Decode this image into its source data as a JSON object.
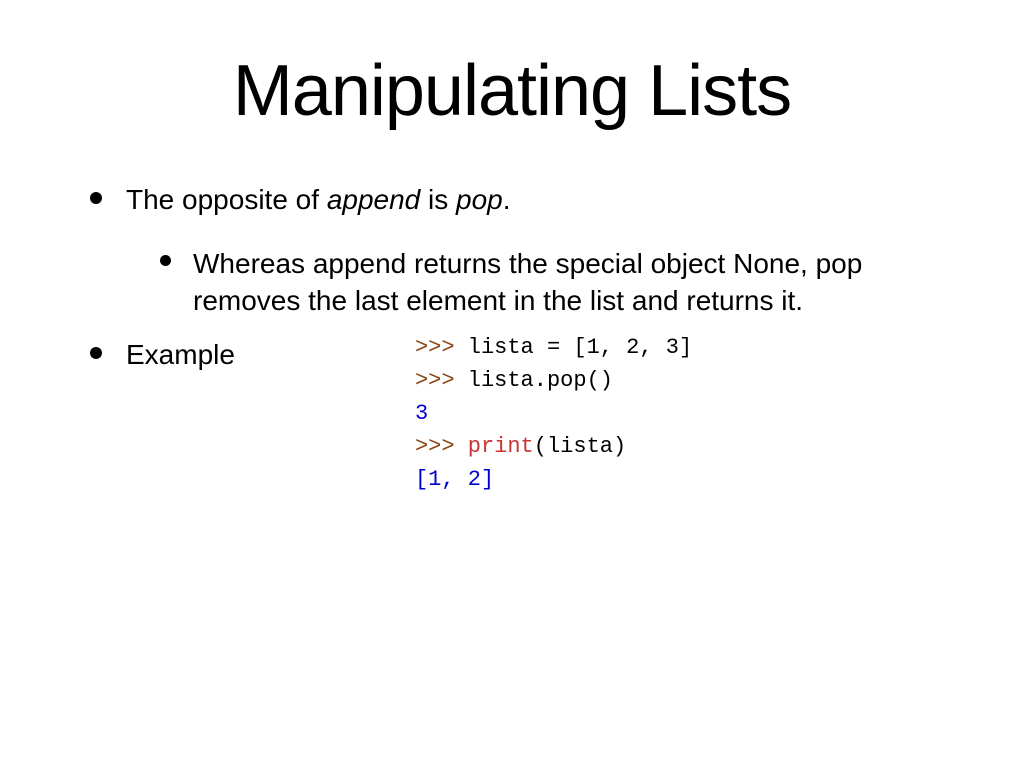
{
  "slide": {
    "title": "Manipulating Lists",
    "bullet1": {
      "prefix": "The opposite of ",
      "word_append": "append",
      "mid": " is ",
      "word_pop": "pop",
      "suffix": "."
    },
    "bullet1_sub": "Whereas append returns the special object None, pop removes the last element in the list and returns it.",
    "bullet2": "Example",
    "code": {
      "line1_prompt": ">>> ",
      "line1_rest": "lista = [1, 2, 3]",
      "line2_prompt": ">>> ",
      "line2_rest": "lista.pop()",
      "line3": "3",
      "line4_prompt": ">>> ",
      "line4_func": "print",
      "line4_rest": "(lista)",
      "line5": "[1, 2]"
    }
  }
}
